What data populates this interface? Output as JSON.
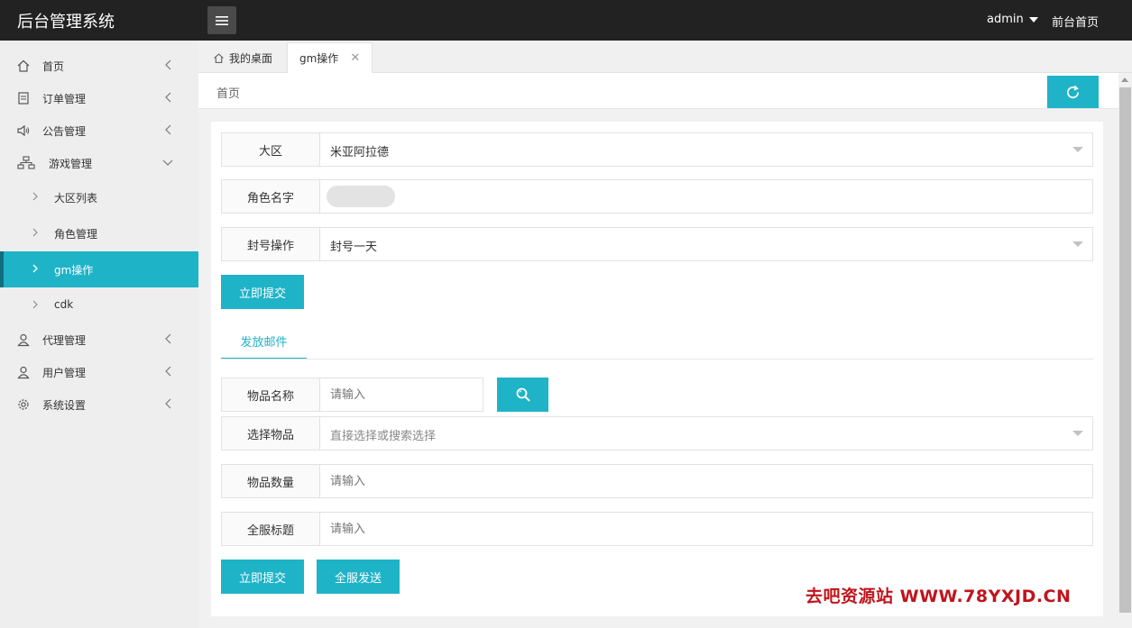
{
  "header": {
    "app_title": "后台管理系统",
    "user_label": "admin",
    "front_link": "前台首页"
  },
  "sidebar": {
    "items": [
      {
        "label": "首页",
        "icon": "home-icon"
      },
      {
        "label": "订单管理",
        "icon": "document-icon"
      },
      {
        "label": "公告管理",
        "icon": "speaker-icon"
      },
      {
        "label": "游戏管理",
        "icon": "sitemap-icon",
        "expanded": true
      },
      {
        "label": "代理管理",
        "icon": "user-icon"
      },
      {
        "label": "用户管理",
        "icon": "user-icon"
      },
      {
        "label": "系统设置",
        "icon": "gear-icon"
      }
    ],
    "sub_items": [
      {
        "label": "大区列表"
      },
      {
        "label": "角色管理"
      },
      {
        "label": "gm操作",
        "active": true
      },
      {
        "label": "cdk"
      }
    ]
  },
  "tabs": {
    "home_label": "我的桌面",
    "active_label": "gm操作",
    "close_glyph": "✕"
  },
  "breadcrumb": "首页",
  "ban_form": {
    "region_label": "大区",
    "region_value": "米亚阿拉德",
    "role_label": "角色名字",
    "ban_label": "封号操作",
    "ban_value": "封号一天",
    "submit_label": "立即提交"
  },
  "mail_form": {
    "tab_label": "发放邮件",
    "item_name_label": "物品名称",
    "item_name_placeholder": "请输入",
    "select_item_label": "选择物品",
    "select_item_placeholder": "直接选择或搜索选择",
    "quantity_label": "物品数量",
    "quantity_placeholder": "请输入",
    "title_label": "全服标题",
    "title_placeholder": "请输入",
    "submit_label": "立即提交",
    "send_all_label": "全服发送"
  },
  "watermark": "去吧资源站  WWW.78YXJD.CN",
  "colors": {
    "accent": "#1fb3c8",
    "header_bg": "#222222",
    "watermark": "#c0141c"
  }
}
